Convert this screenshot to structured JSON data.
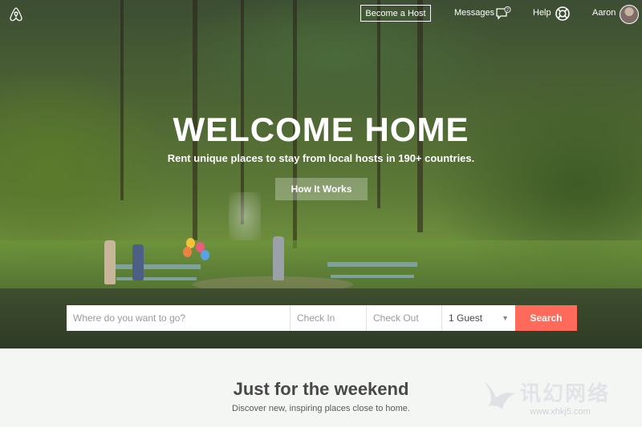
{
  "nav": {
    "become_host": "Become a Host",
    "messages": "Messages",
    "messages_count": "2",
    "help": "Help",
    "user_name": "Aaron"
  },
  "hero": {
    "title": "WELCOME HOME",
    "subtitle": "Rent unique places to stay from local hosts in 190+ countries.",
    "how_it_works": "How It Works"
  },
  "search": {
    "where_placeholder": "Where do you want to go?",
    "check_in_placeholder": "Check In",
    "check_out_placeholder": "Check Out",
    "guests_value": "1 Guest",
    "search_label": "Search"
  },
  "section": {
    "title": "Just for the weekend",
    "subtitle": "Discover new, inspiring places close to home."
  },
  "watermark": {
    "text": "讯幻网络",
    "url": "www.xhkj5.com"
  },
  "colors": {
    "accent": "#ff6a5b",
    "text_dark": "#484848"
  }
}
